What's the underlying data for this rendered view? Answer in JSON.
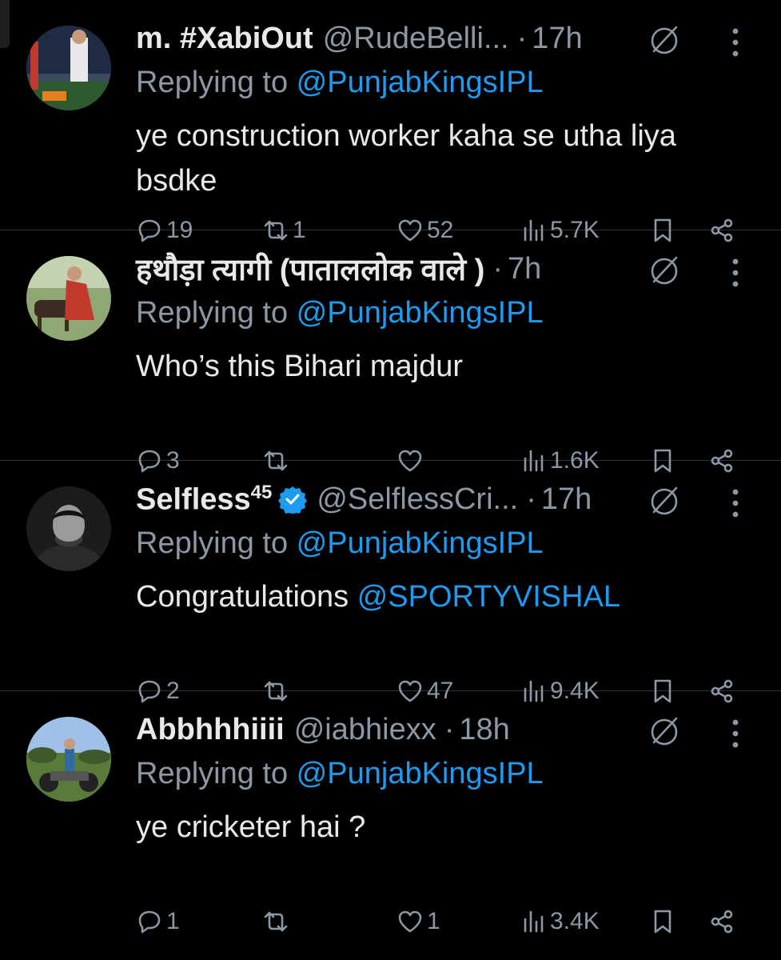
{
  "colors": {
    "background": "#000000",
    "text": "#e7e9ea",
    "muted": "#8b98a5",
    "link": "#1d9bf0",
    "divider": "#2f3336"
  },
  "icons": {
    "reply": "speech-bubble-icon",
    "retweet": "retweet-arrows-icon",
    "like": "heart-icon",
    "views": "bar-chart-icon",
    "bookmark": "bookmark-icon",
    "share": "share-nodes-icon",
    "grok": "grok-icon",
    "more": "vertical-dots-icon",
    "verified": "verified-badge-icon"
  },
  "tweets": [
    {
      "name": "m. #XabiOut",
      "handle": "@RudeBelli...",
      "dot": "·",
      "time": "17h",
      "replying_prefix": "Replying to",
      "replying_to": "@PunjabKingsIPL",
      "text": "ye construction worker kaha se utha liya bsdke",
      "replies": "19",
      "retweets": "1",
      "likes": "52",
      "views": "5.7K"
    },
    {
      "name": "हथौड़ा त्यागी (पाताललोक वाले )",
      "handle": "",
      "dot": "·",
      "time": "7h",
      "replying_prefix": "Replying to",
      "replying_to": "@PunjabKingsIPL",
      "text": "Who’s this Bihari majdur",
      "replies": "3",
      "retweets": "",
      "likes": "",
      "views": "1.6K"
    },
    {
      "name": "Selfless",
      "name_sup": "45",
      "verified": true,
      "handle": "@SelflessCri...",
      "dot": "·",
      "time": "17h",
      "replying_prefix": "Replying to",
      "replying_to": "@PunjabKingsIPL",
      "text_prefix": "Congratulations",
      "text_mention": "@SPORTYVISHAL",
      "replies": "2",
      "retweets": "",
      "likes": "47",
      "views": "9.4K"
    },
    {
      "name": "Abbhhhiiii",
      "handle": "@iabhiexx",
      "dot": "·",
      "time": "18h",
      "replying_prefix": "Replying to",
      "replying_to": "@PunjabKingsIPL",
      "text": "ye cricketer hai ?",
      "replies": "1",
      "retweets": "",
      "likes": "1",
      "views": "3.4K"
    }
  ]
}
